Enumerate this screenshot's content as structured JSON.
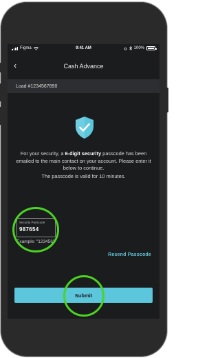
{
  "statusbar": {
    "carrier": "Figma",
    "time": "9:41 AM",
    "battery": "100%"
  },
  "navbar": {
    "back": "‹",
    "title": "Cash Advance"
  },
  "load": {
    "label": "Load #1234567890"
  },
  "message": {
    "p1": "For your security, a ",
    "p1_bold": "6-digit security",
    "p2": " passcode has been emailed to the main contact on your account. Please enter it below to continue.",
    "validity": "The passcode is valid for 10 minutes."
  },
  "passcode": {
    "label": "Security Passcode",
    "value": "987654",
    "example": "Example: \"123456\""
  },
  "resend": {
    "label": "Resend Passcode"
  },
  "submit": {
    "label": "Submit"
  },
  "colors": {
    "accent": "#5cc6dc",
    "highlight_ring": "#4bd421",
    "background": "#1b1c1e"
  }
}
